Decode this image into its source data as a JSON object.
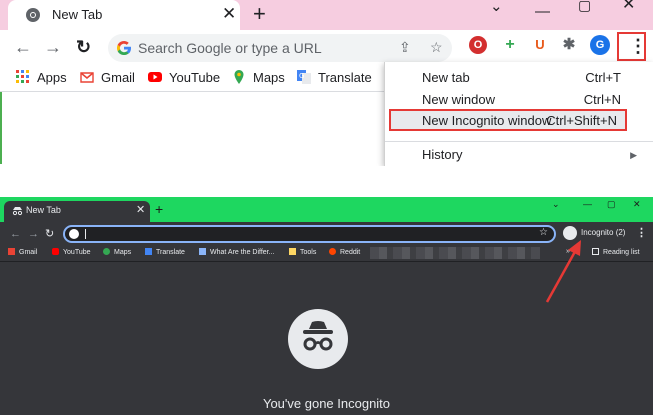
{
  "top": {
    "tab_title": "New Tab",
    "omnibox_placeholder": "Search Google or type a URL",
    "profile_letter": "G",
    "bookmarks": [
      "Apps",
      "Gmail",
      "YouTube",
      "Maps",
      "Translate"
    ],
    "menu": {
      "items": [
        {
          "label": "New tab",
          "shortcut": "Ctrl+T"
        },
        {
          "label": "New window",
          "shortcut": "Ctrl+N"
        },
        {
          "label": "New Incognito window",
          "shortcut": "Ctrl+Shift+N"
        },
        {
          "label": "History",
          "shortcut": ""
        }
      ]
    },
    "colors": {
      "tabstrip": "#f6cde0",
      "highlight": "#e53935"
    }
  },
  "bottom": {
    "tab_title": "New Tab",
    "incognito_label": "Incognito (2)",
    "bookmarks": [
      "Gmail",
      "YouTube",
      "Maps",
      "Translate",
      "What Are the Differ...",
      "Tools",
      "Reddit"
    ],
    "reading_list": "Reading list",
    "headline": "You've gone Incognito",
    "colors": {
      "tabstrip": "#1ed760",
      "background": "#35363a",
      "omnibox_focus": "#8ab4f8",
      "arrow": "#e53935"
    }
  }
}
